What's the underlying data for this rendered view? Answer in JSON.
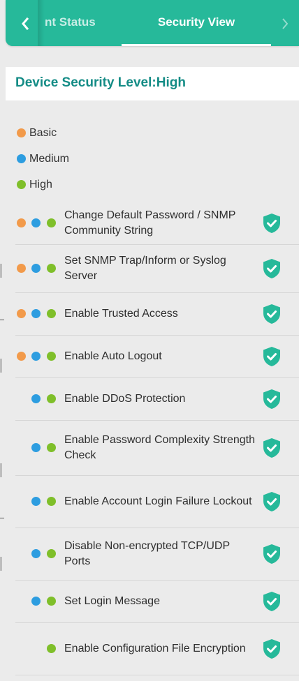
{
  "tabs": {
    "prev_icon": "chevron-left-icon",
    "partial_label": "nt Status",
    "active_label": "Security View",
    "next_icon": "chevron-right-icon"
  },
  "level": {
    "text": "Device Security Level:High"
  },
  "legend": [
    {
      "label": "Basic",
      "color": "#f29a4a"
    },
    {
      "label": "Medium",
      "color": "#2d9de0"
    },
    {
      "label": "High",
      "color": "#7fbf2a"
    }
  ],
  "items": [
    {
      "label": "Change Default Password / SNMP Community String",
      "levels": [
        "basic",
        "medium",
        "high"
      ],
      "status_icon": "shield-check-icon"
    },
    {
      "label": "Set SNMP Trap/Inform or Syslog Server",
      "levels": [
        "basic",
        "medium",
        "high"
      ],
      "status_icon": "shield-check-icon"
    },
    {
      "label": "Enable Trusted Access",
      "levels": [
        "basic",
        "medium",
        "high"
      ],
      "status_icon": "shield-check-icon"
    },
    {
      "label": "Enable Auto Logout",
      "levels": [
        "basic",
        "medium",
        "high"
      ],
      "status_icon": "shield-check-icon"
    },
    {
      "label": "Enable DDoS Protection",
      "levels": [
        "medium",
        "high"
      ],
      "status_icon": "shield-check-icon"
    },
    {
      "label": "Enable Password Complexity Strength Check",
      "levels": [
        "medium",
        "high"
      ],
      "status_icon": "shield-check-icon"
    },
    {
      "label": "Enable Account Login Failure Lockout",
      "levels": [
        "medium",
        "high"
      ],
      "status_icon": "shield-check-icon"
    },
    {
      "label": "Disable Non-encrypted TCP/UDP Ports",
      "levels": [
        "medium",
        "high"
      ],
      "status_icon": "shield-check-icon"
    },
    {
      "label": "Set Login Message",
      "levels": [
        "medium",
        "high"
      ],
      "status_icon": "shield-check-icon"
    },
    {
      "label": "Enable Configuration File Encryption",
      "levels": [
        "high"
      ],
      "status_icon": "shield-check-icon"
    }
  ],
  "colors": {
    "header": "#26b99a",
    "level_text": "#148c86",
    "shield": "#26b99a"
  }
}
